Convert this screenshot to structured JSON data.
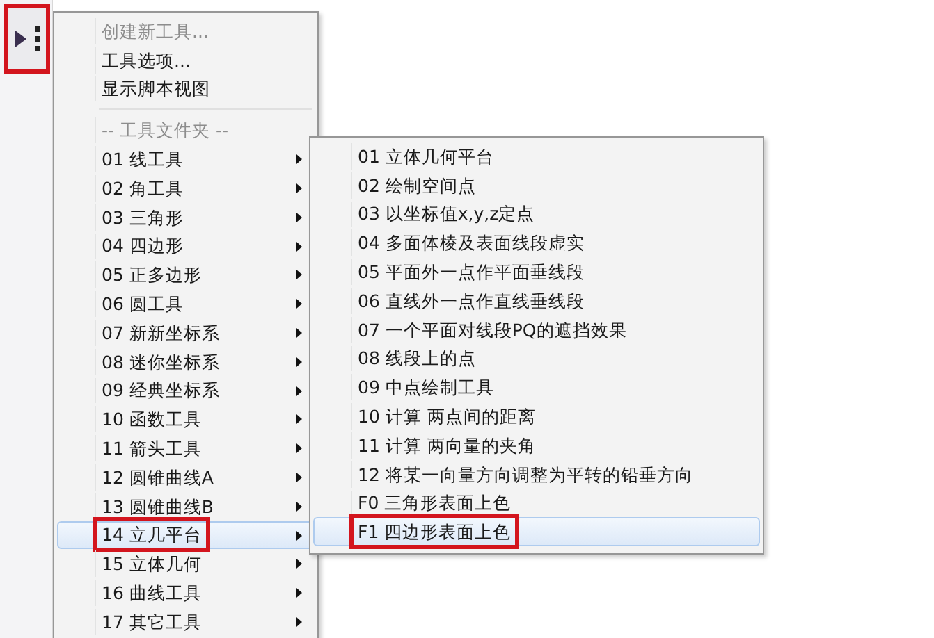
{
  "toolbar": {
    "menu_button": {
      "annotated": true
    }
  },
  "menu": {
    "items": [
      {
        "kind": "command",
        "label": "创建新工具...",
        "disabled": true
      },
      {
        "kind": "command",
        "label": "工具选项...",
        "disabled": false
      },
      {
        "kind": "command",
        "label": "显示脚本视图",
        "disabled": false
      },
      {
        "kind": "separator"
      },
      {
        "kind": "header",
        "label": "-- 工具文件夹 --"
      },
      {
        "kind": "folder",
        "label": "01 线工具",
        "selected": false,
        "annotated": false
      },
      {
        "kind": "folder",
        "label": "02 角工具",
        "selected": false,
        "annotated": false
      },
      {
        "kind": "folder",
        "label": "03 三角形",
        "selected": false,
        "annotated": false
      },
      {
        "kind": "folder",
        "label": "04 四边形",
        "selected": false,
        "annotated": false
      },
      {
        "kind": "folder",
        "label": "05 正多边形",
        "selected": false,
        "annotated": false
      },
      {
        "kind": "folder",
        "label": "06 圆工具",
        "selected": false,
        "annotated": false
      },
      {
        "kind": "folder",
        "label": "07 新新坐标系",
        "selected": false,
        "annotated": false
      },
      {
        "kind": "folder",
        "label": "08 迷你坐标系",
        "selected": false,
        "annotated": false
      },
      {
        "kind": "folder",
        "label": "09 经典坐标系",
        "selected": false,
        "annotated": false
      },
      {
        "kind": "folder",
        "label": "10 函数工具",
        "selected": false,
        "annotated": false
      },
      {
        "kind": "folder",
        "label": "11 箭头工具",
        "selected": false,
        "annotated": false
      },
      {
        "kind": "folder",
        "label": "12 圆锥曲线A",
        "selected": false,
        "annotated": false
      },
      {
        "kind": "folder",
        "label": "13 圆锥曲线B",
        "selected": false,
        "annotated": false
      },
      {
        "kind": "folder",
        "label": "14 立几平台",
        "selected": true,
        "annotated": true
      },
      {
        "kind": "folder",
        "label": "15 立体几何",
        "selected": false,
        "annotated": false
      },
      {
        "kind": "folder",
        "label": "16 曲线工具",
        "selected": false,
        "annotated": false
      },
      {
        "kind": "folder",
        "label": "17 其它工具",
        "selected": false,
        "annotated": false
      }
    ]
  },
  "submenu": {
    "items": [
      {
        "label": "01 立体几何平台",
        "selected": false,
        "annotated": false
      },
      {
        "label": "02 绘制空间点",
        "selected": false,
        "annotated": false
      },
      {
        "label": "03 以坐标值x,y,z定点",
        "selected": false,
        "annotated": false
      },
      {
        "label": "04 多面体棱及表面线段虚实",
        "selected": false,
        "annotated": false
      },
      {
        "label": "05 平面外一点作平面垂线段",
        "selected": false,
        "annotated": false
      },
      {
        "label": "06 直线外一点作直线垂线段",
        "selected": false,
        "annotated": false
      },
      {
        "label": "07 一个平面对线段PQ的遮挡效果",
        "selected": false,
        "annotated": false
      },
      {
        "label": "08 线段上的点",
        "selected": false,
        "annotated": false
      },
      {
        "label": "09 中点绘制工具",
        "selected": false,
        "annotated": false
      },
      {
        "label": "10 计算  两点间的距离",
        "selected": false,
        "annotated": false
      },
      {
        "label": "11 计算  两向量的夹角",
        "selected": false,
        "annotated": false
      },
      {
        "label": "12 将某一向量方向调整为平转的铅垂方向",
        "selected": false,
        "annotated": false
      },
      {
        "label": "F0 三角形表面上色",
        "selected": false,
        "annotated": false
      },
      {
        "label": "F1 四边形表面上色",
        "selected": true,
        "annotated": true
      }
    ]
  }
}
